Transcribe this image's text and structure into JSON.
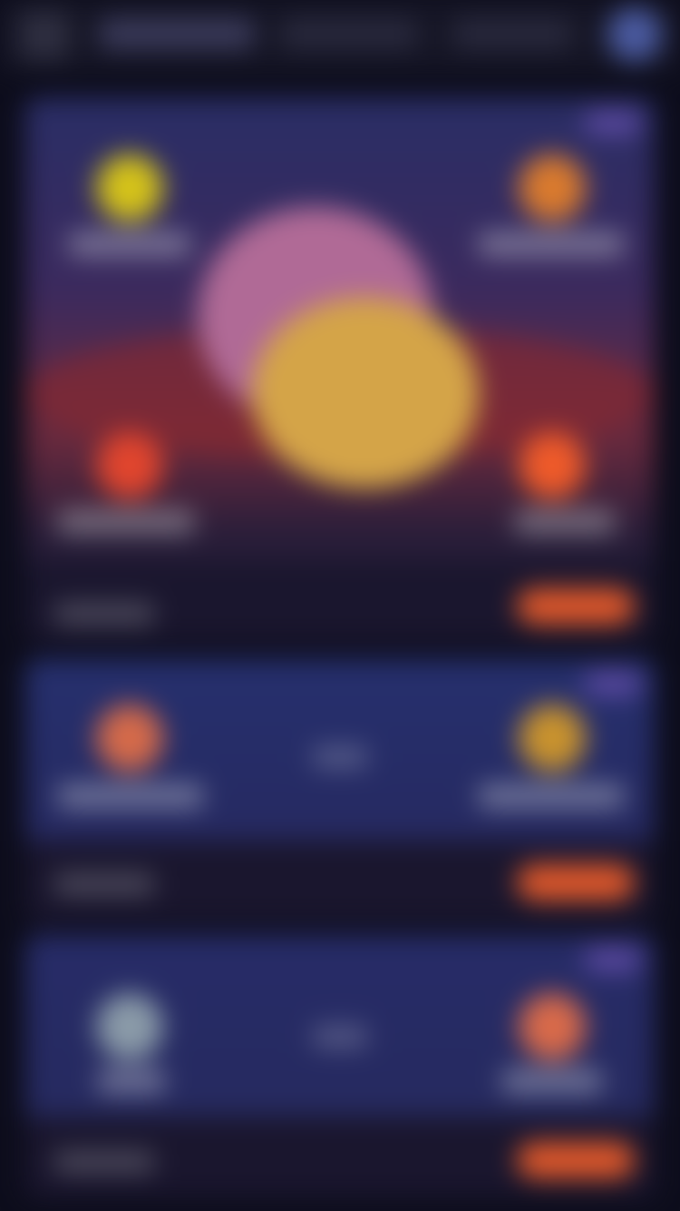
{
  "topbar": {
    "menu_icon": "menu-icon",
    "tabs": [
      "",
      "",
      ""
    ],
    "avatar_icon": "user-avatar-icon"
  },
  "matches": [
    {
      "badge": "",
      "home_team": "",
      "away_team": "",
      "vs": "",
      "time": "",
      "bet_label": "",
      "home_logo_color": "#d4c21a",
      "away_logo_color": "#d97a2e",
      "row2_left_logo_color": "#e0452e",
      "row2_right_logo_color": "#ee5a2a"
    },
    {
      "badge": "",
      "home_team": "",
      "away_team": "",
      "vs": "",
      "time": "",
      "bet_label": "",
      "home_logo_color": "#d46a4a",
      "away_logo_color": "#c8922e"
    },
    {
      "badge": "",
      "home_team": "",
      "away_team": "",
      "vs": "",
      "time": "",
      "bet_label": "",
      "home_logo_color": "#8a9aa8",
      "away_logo_color": "#d86a4a"
    }
  ],
  "colors": {
    "background": "#0d0d1c",
    "accent": "#e0582a",
    "card": "#262a62"
  }
}
